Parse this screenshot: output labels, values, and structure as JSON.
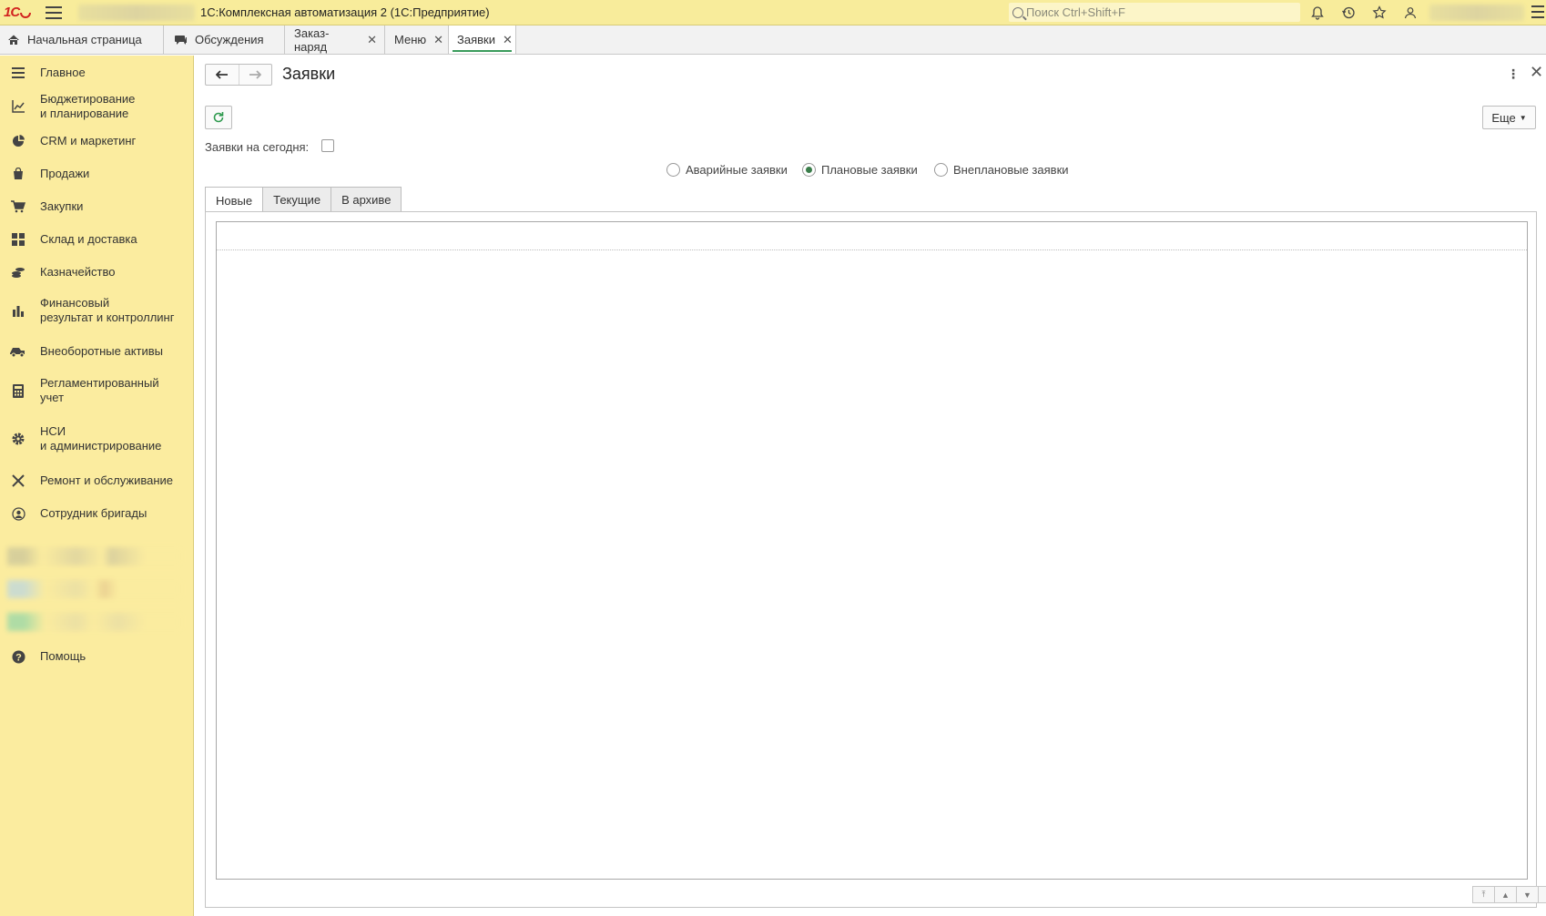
{
  "titlebar": {
    "app_title": "1С:Комплексная автоматизация 2  (1С:Предприятие)",
    "search_placeholder": "Поиск Ctrl+Shift+F"
  },
  "tabs": [
    {
      "label": "Начальная страница",
      "icon": "home-icon",
      "closable": false
    },
    {
      "label": "Обсуждения",
      "icon": "chat-icon",
      "closable": false
    },
    {
      "label": "Заказ-наряд",
      "closable": true
    },
    {
      "label": "Меню",
      "closable": true
    },
    {
      "label": "Заявки",
      "closable": true,
      "active": true
    }
  ],
  "sidebar": {
    "items": [
      {
        "label": "Главное",
        "icon": "menu-lines-icon"
      },
      {
        "label": "Бюджетирование\nи планирование",
        "icon": "budget-chart-icon"
      },
      {
        "label": "CRM и маркетинг",
        "icon": "pie-chart-icon"
      },
      {
        "label": "Продажи",
        "icon": "shopping-bag-icon"
      },
      {
        "label": "Закупки",
        "icon": "cart-icon"
      },
      {
        "label": "Склад и доставка",
        "icon": "warehouse-grid-icon"
      },
      {
        "label": "Казначейство",
        "icon": "coins-icon"
      },
      {
        "label": "Финансовый\nрезультат и контроллинг",
        "icon": "bar-chart-icon"
      },
      {
        "label": "Внеоборотные активы",
        "icon": "truck-icon"
      },
      {
        "label": "Регламентированный\nучет",
        "icon": "calculator-icon"
      },
      {
        "label": "НСИ\nи администрирование",
        "icon": "gear-icon"
      },
      {
        "label": "Ремонт и обслуживание",
        "icon": "tools-icon"
      },
      {
        "label": "Сотрудник бригады",
        "icon": "user-circle-icon"
      },
      {
        "label": "Помощь",
        "icon": "help-icon"
      }
    ]
  },
  "form": {
    "title": "Заявки",
    "more_button": "Еще",
    "today_label": "Заявки на сегодня:",
    "today_checked": false,
    "radio_options": [
      {
        "label": "Аварийные заявки",
        "selected": false
      },
      {
        "label": "Плановые заявки",
        "selected": true
      },
      {
        "label": "Внеплановые заявки",
        "selected": false
      }
    ],
    "tabs": [
      {
        "label": "Новые",
        "active": true
      },
      {
        "label": "Текущие",
        "active": false
      },
      {
        "label": "В архиве",
        "active": false
      }
    ]
  },
  "colors": {
    "titlebar_bg": "#f8ec9b",
    "sidebar_bg": "#fbec9f",
    "accent_green": "#3a9b5b",
    "logo_red": "#d2231f"
  }
}
